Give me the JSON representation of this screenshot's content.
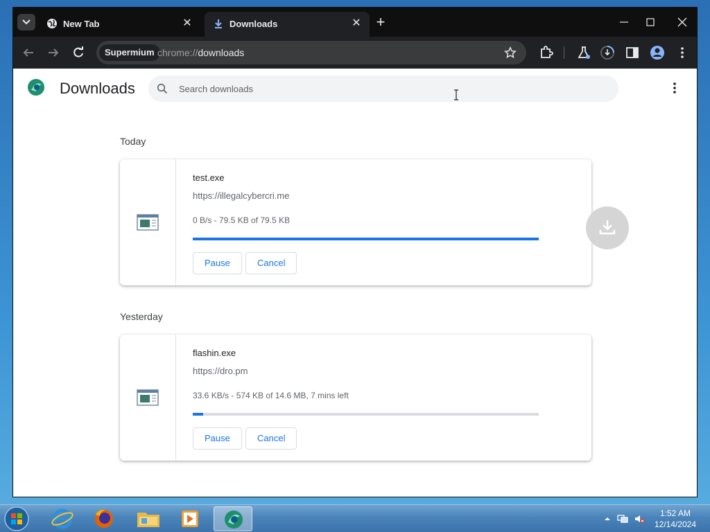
{
  "browser": {
    "tabs": [
      {
        "title": "New Tab",
        "icon": "globe-icon",
        "active": false
      },
      {
        "title": "Downloads",
        "icon": "download-arrow-icon",
        "active": true
      }
    ],
    "site_chip": "Supermium",
    "url_scheme": "chrome://",
    "url_path": "downloads"
  },
  "page": {
    "title": "Downloads",
    "search_placeholder": "Search downloads",
    "sections": [
      {
        "label": "Today",
        "item": {
          "file_name": "test.exe",
          "url": "https://illegalcybercri.me",
          "status": "0 B/s - 79.5 KB of 79.5 KB",
          "progress": 1.0,
          "pause_label": "Pause",
          "cancel_label": "Cancel"
        }
      },
      {
        "label": "Yesterday",
        "item": {
          "file_name": "flashin.exe",
          "url": "https://dro.pm",
          "status": "33.6 KB/s - 574 KB of 14.6 MB, 7 mins left",
          "progress": 0.03,
          "pause_label": "Pause",
          "cancel_label": "Cancel"
        }
      }
    ]
  },
  "taskbar": {
    "apps": [
      "internet-explorer-icon",
      "firefox-icon",
      "file-explorer-icon",
      "media-player-icon",
      "supermium-icon"
    ],
    "time": "1:52 AM",
    "date": "12/14/2024"
  },
  "colors": {
    "accent": "#1a73e8",
    "tab_bg": "#202124",
    "tabstrip_bg": "#0f0f10"
  }
}
